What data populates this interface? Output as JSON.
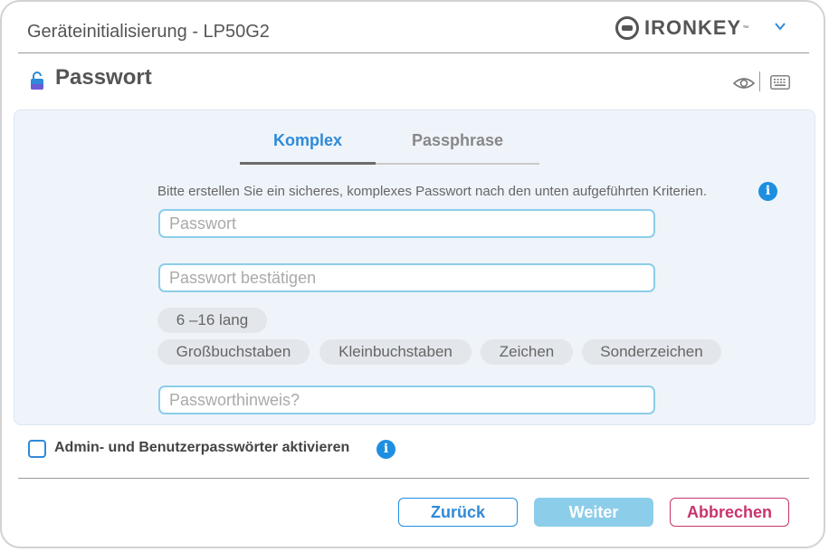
{
  "window": {
    "title": "Geräteinitialisierung - LP50G2"
  },
  "brand": {
    "logo_text": "IRONKEY",
    "logo_tm": "™"
  },
  "section": {
    "title": "Passwort"
  },
  "tabs": [
    {
      "label": "Komplex",
      "active": true
    },
    {
      "label": "Passphrase",
      "active": false
    }
  ],
  "form": {
    "instructions": "Bitte erstellen Sie ein sicheres, komplexes Passwort nach den unten aufgeführten Kriterien.",
    "password_placeholder": "Passwort",
    "password_value": "",
    "confirm_placeholder": "Passwort bestätigen",
    "confirm_value": "",
    "hint_placeholder": "Passworthinweis?",
    "hint_value": ""
  },
  "criteria": {
    "length": "6 –16 lang",
    "uppercase": "Großbuchstaben",
    "lowercase": "Kleinbuchstaben",
    "digits": "Zeichen",
    "special": "Sonderzeichen"
  },
  "admin_option": {
    "label": "Admin- und Benutzerpasswörter aktivieren",
    "checked": false
  },
  "buttons": {
    "back": "Zurück",
    "next": "Weiter",
    "cancel": "Abbrechen"
  },
  "colors": {
    "accent": "#2f8ad8",
    "cancel": "#c9336e",
    "field_border": "#8ccdea",
    "panel": "#eff4fa"
  },
  "icons": {
    "chevron": "chevron-down-icon",
    "lock": "lock-icon",
    "eye": "eye-icon",
    "keyboard": "keyboard-icon",
    "info": "info-icon"
  }
}
